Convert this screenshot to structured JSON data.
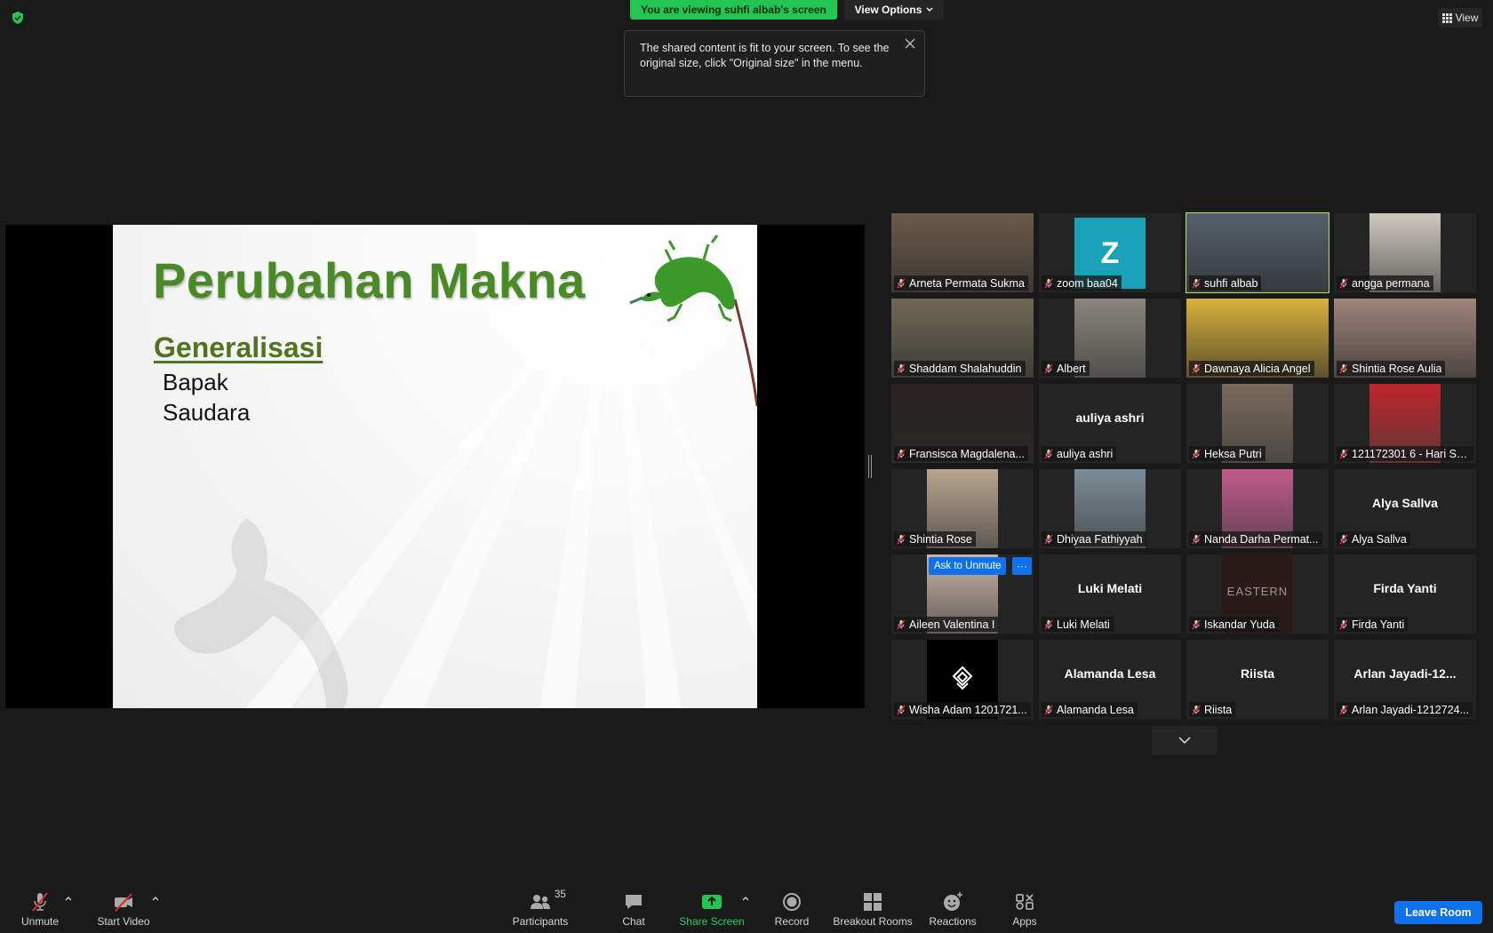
{
  "banner": {
    "viewing": "You are viewing suhfi albab's screen",
    "view_options": "View Options",
    "view": "View"
  },
  "tooltip": {
    "text": "The shared content is fit to your screen. To see the original size, click \"Original size\" in the menu."
  },
  "slide": {
    "title": "Perubahan Makna",
    "subtitle": "Generalisasi",
    "lines": [
      "Bapak",
      "Saudara"
    ]
  },
  "participants": [
    {
      "name": "Arneta Permata Sukma",
      "tile": "Arneta Permata Sukma",
      "kind": "video",
      "bg": "#6b5a4a"
    },
    {
      "name": "zoom baa04",
      "tile": "zoom baa04",
      "kind": "letter",
      "letter": "Z"
    },
    {
      "name": "suhfi albab",
      "tile": "suhfi albab",
      "kind": "video",
      "bg": "#55606b",
      "active": true
    },
    {
      "name": "angga permana",
      "tile": "angga permana",
      "kind": "video-center",
      "bg": "#cfcac0"
    },
    {
      "name": "Shaddam Shalahuddin",
      "tile": "Shaddam Shalahuddin",
      "kind": "video",
      "bg": "#6f6a55"
    },
    {
      "name": "Albert",
      "tile": "Albert",
      "kind": "video-center",
      "bg": "#8a857d"
    },
    {
      "name": "Dawnaya Alicia Angel",
      "tile": "Dawnaya Alicia Angel",
      "kind": "video",
      "bg": "#d9b23a"
    },
    {
      "name": "Shintia Rose Aulia",
      "tile": "Shintia Rose Aulia",
      "kind": "video",
      "bg": "#a0857a"
    },
    {
      "name": "Fransisca Magdalena...",
      "tile": "Fransisca Magdalena...",
      "kind": "video",
      "bg": "#2a2222"
    },
    {
      "name": "auliya ashri",
      "tile": "auliya ashri",
      "kind": "name",
      "bigname": "auliya ashri"
    },
    {
      "name": "Heksa Putri",
      "tile": "Heksa Putri",
      "kind": "video-center",
      "bg": "#7a6a5c"
    },
    {
      "name": "121172301 6 - Hari Su...",
      "tile": "121172301 6 - Hari Su...",
      "kind": "video-center",
      "bg": "#c0262b"
    },
    {
      "name": "Shintia Rose",
      "tile": "Shintia Rose",
      "kind": "video-center",
      "bg": "#b9a58f"
    },
    {
      "name": "Dhiyaa Fathiyyah",
      "tile": "Dhiyaa Fathiyyah",
      "kind": "video-center",
      "bg": "#7a8e96"
    },
    {
      "name": "Nanda Darha Permat...",
      "tile": "Nanda Darha Permat...",
      "kind": "video-center",
      "bg": "#c25a8a"
    },
    {
      "name": "Alya Sallva",
      "tile": "Alya Sallva",
      "kind": "name",
      "bigname": "Alya Sallva"
    },
    {
      "name": "Aileen Valentina",
      "tile": "Aileen Valentina I",
      "kind": "video-center",
      "bg": "#c8b4a8",
      "ask": "Ask to Unmute"
    },
    {
      "name": "Luki Melati",
      "tile": "Luki Melati",
      "kind": "name",
      "bigname": "Luki Melati"
    },
    {
      "name": "Iskandar Yuda",
      "tile": "Iskandar Yuda",
      "kind": "eastern",
      "logo": "EASTERN"
    },
    {
      "name": "Firda Yanti",
      "tile": "Firda Yanti",
      "kind": "name",
      "bigname": "Firda Yanti"
    },
    {
      "name": "Wisha Adam 1201721...",
      "tile": "Wisha Adam 1201721...",
      "kind": "logo"
    },
    {
      "name": "Alamanda Lesa",
      "tile": "Alamanda Lesa",
      "kind": "name",
      "bigname": "Alamanda Lesa"
    },
    {
      "name": "Riista",
      "tile": "Riista",
      "kind": "name",
      "bigname": "Riista"
    },
    {
      "name": "Arlan Jayadi-1212724...",
      "tile": "Arlan Jayadi-1212724...",
      "kind": "name",
      "bigname": "Arlan  Jayadi-12..."
    }
  ],
  "toolbar": {
    "unmute": "Unmute",
    "start_video": "Start Video",
    "participants": "Participants",
    "participants_count": "35",
    "chat": "Chat",
    "share_screen": "Share Screen",
    "record": "Record",
    "breakout_rooms": "Breakout Rooms",
    "reactions": "Reactions",
    "apps": "Apps",
    "leave": "Leave Room"
  },
  "colors": {
    "accent_blue": "#0e72ed",
    "share_green": "#23c552",
    "active_speaker": "#b8e26a",
    "muted_red": "#e02828"
  }
}
